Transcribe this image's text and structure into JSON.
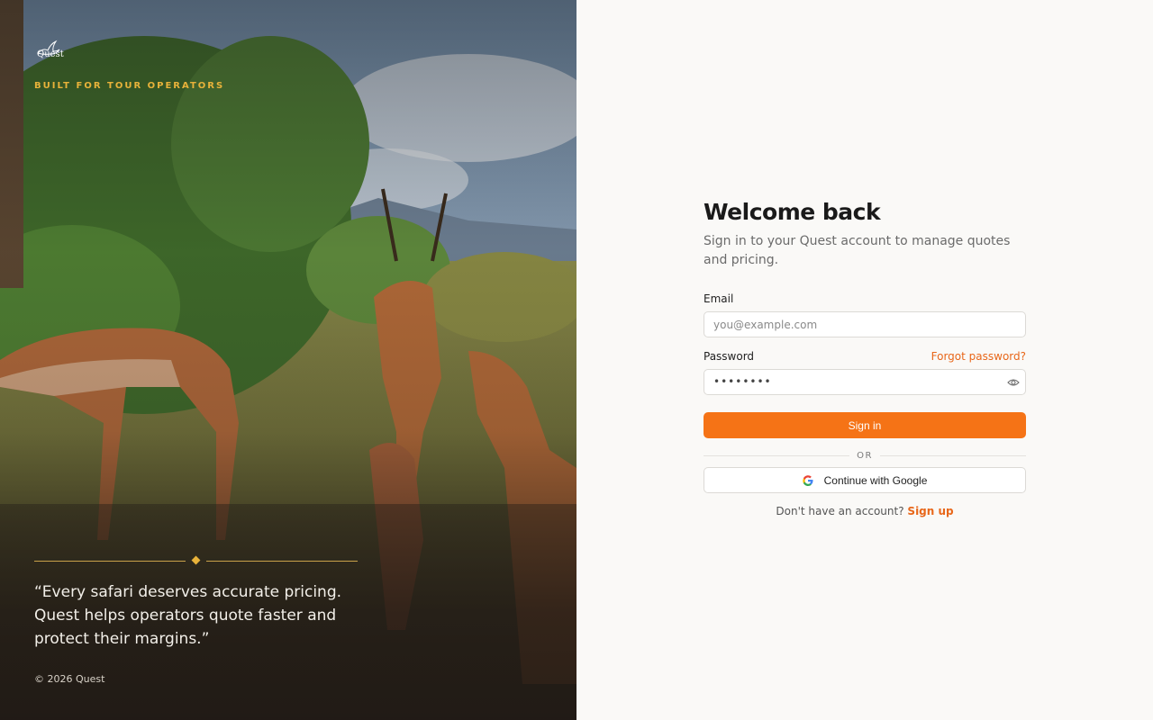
{
  "hero": {
    "logo_text": "Quest",
    "tagline": "BUILT FOR TOUR OPERATORS",
    "quote": "“Every safari deserves accurate pricing. Quest helps operators quote faster and protect their margins.”",
    "copyright": "© 2026 Quest",
    "accent_color": "#e8b23a"
  },
  "form": {
    "title": "Welcome back",
    "subtitle": "Sign in to your Quest account to manage quotes and pricing.",
    "email_label": "Email",
    "email_placeholder": "you@example.com",
    "password_label": "Password",
    "forgot_link": "Forgot password?",
    "password_value": "••••••••",
    "password_toggle_icon": "eye-icon",
    "sign_in_label": "Sign in",
    "divider_text": "OR",
    "google_label": "Continue with Google",
    "google_icon": "google-icon",
    "signup_prompt": "Don't have an account?",
    "signup_link": "Sign up",
    "primary_color": "#f57316",
    "link_color": "#e8671a"
  }
}
